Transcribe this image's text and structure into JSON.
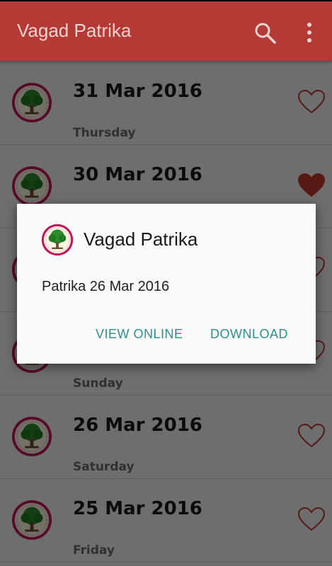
{
  "app": {
    "title": "Vagad Patrika",
    "brand_color": "#b33a35",
    "accent_color": "#c0392b"
  },
  "toolbar": {
    "search_icon": "search-icon",
    "menu_icon": "more-vert-icon"
  },
  "list": {
    "items": [
      {
        "date": "31 Mar 2016",
        "day": "Thursday",
        "favorite": false
      },
      {
        "date": "30 Mar 2016",
        "day": "",
        "favorite": true
      },
      {
        "date": "",
        "day": "",
        "favorite": false
      },
      {
        "date": "",
        "day": "Sunday",
        "favorite": false
      },
      {
        "date": "26 Mar 2016",
        "day": "Saturday",
        "favorite": false
      },
      {
        "date": "25 Mar 2016",
        "day": "Friday",
        "favorite": false
      }
    ]
  },
  "dialog": {
    "title": "Vagad Patrika",
    "message": "Patrika 26 Mar 2016",
    "view_online_label": "VIEW ONLINE",
    "download_label": "DOWNLOAD"
  }
}
